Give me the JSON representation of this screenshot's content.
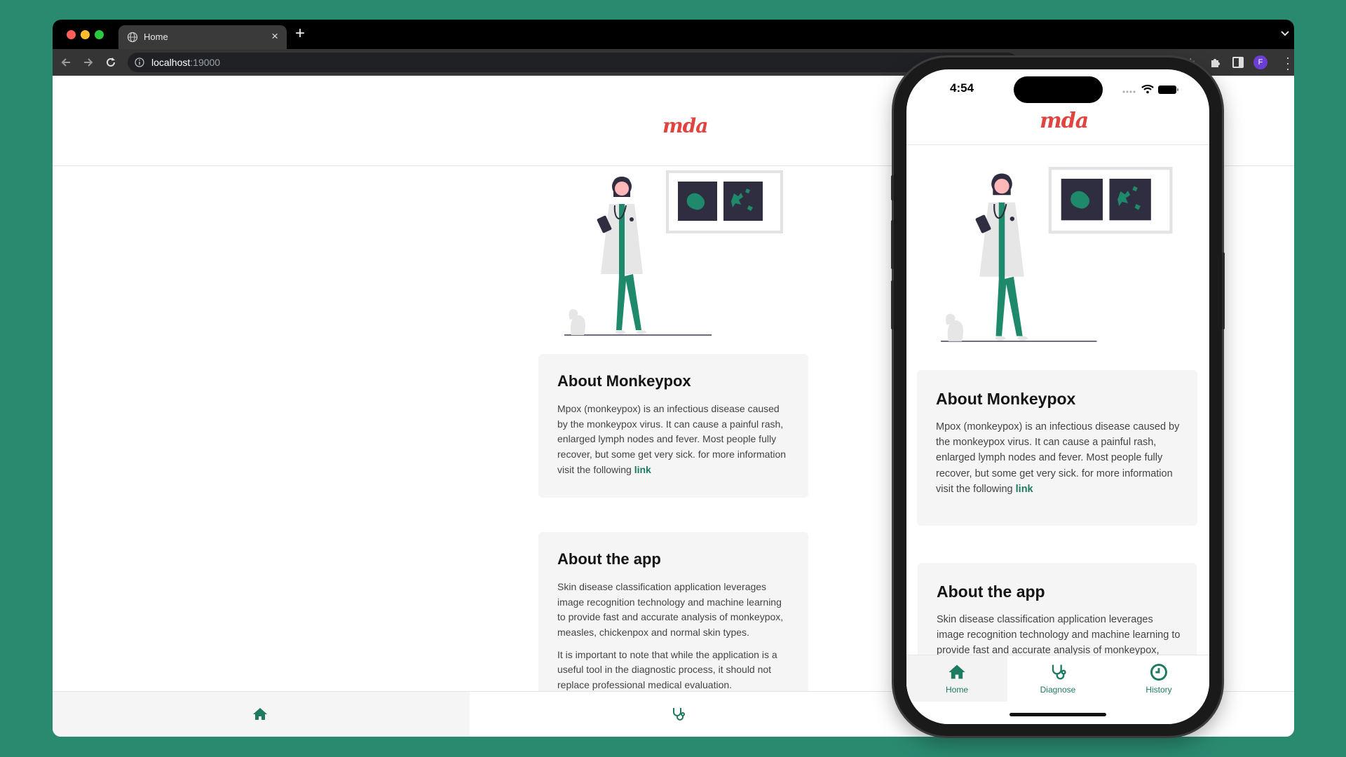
{
  "browser": {
    "tab_title": "Home",
    "url_host": "localhost",
    "url_port": ":19000",
    "profile_initial": "F"
  },
  "app": {
    "logo": "mda",
    "about_monkeypox": {
      "title": "About Monkeypox",
      "body": "Mpox (monkeypox) is an infectious disease caused by the monkeypox virus. It can cause a painful rash, enlarged lymph nodes and fever. Most people fully recover, but some get very sick. for more information visit the following",
      "link": "link"
    },
    "about_app": {
      "title": "About the app",
      "body": "Skin disease classification application leverages image recognition technology and machine learning to provide fast and accurate analysis of monkeypox, measles, chickenpox and normal skin types.",
      "note": "It is important to note that while the application is a useful tool in the diagnostic process, it should not replace professional medical evaluation."
    },
    "nav": {
      "home": "Home",
      "diagnose": "Diagnose",
      "history": "History"
    },
    "accent_color": "#1e7a61",
    "logo_color": "#e0443f"
  },
  "phone": {
    "time": "4:54"
  }
}
